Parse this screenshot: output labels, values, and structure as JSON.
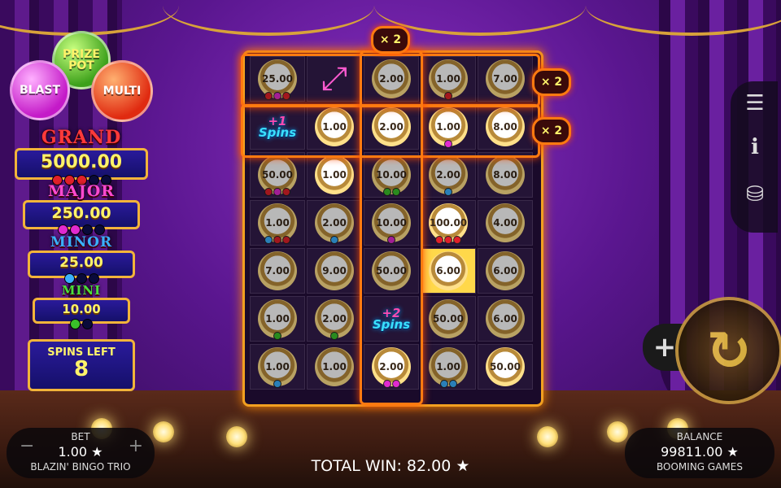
{
  "orbs": {
    "prize": "PRIZE POT",
    "blast": "BLAST",
    "multi": "MULTI"
  },
  "jackpots": [
    {
      "name": "GRAND",
      "value": "5000.00",
      "color": "#ff3a3a",
      "dots": [
        "#e0202a",
        "#e0202a",
        "#e0202a",
        "#0a0a3a",
        "#0a0a3a"
      ]
    },
    {
      "name": "MAJOR",
      "value": "250.00",
      "color": "#ff4ad0",
      "dots": [
        "#e02ad0",
        "#e02ad0",
        "#0a0a3a",
        "#0a0a3a"
      ]
    },
    {
      "name": "MINOR",
      "value": "25.00",
      "color": "#3ab0ff",
      "dots": [
        "#3ab0ff",
        "#0a0a3a",
        "#0a0a3a"
      ]
    },
    {
      "name": "MINI",
      "value": "10.00",
      "color": "#4ae03a",
      "dots": [
        "#3ac02a",
        "#0a0a3a"
      ]
    }
  ],
  "spins_left": {
    "label": "SPINS LEFT",
    "value": "8"
  },
  "multipliers": {
    "col": "× 2",
    "row1": "× 2",
    "row2": "× 2"
  },
  "grid": [
    [
      {
        "v": "25.00",
        "d": [
          "#e0202a",
          "#e02ad0",
          "#e0202a"
        ],
        "dim": true
      },
      {
        "t": "arrow"
      },
      {
        "v": "2.00",
        "dim": true
      },
      {
        "v": "1.00",
        "d": [
          "#e0202a"
        ],
        "dim": true
      },
      {
        "v": "7.00",
        "dim": true
      }
    ],
    [
      {
        "t": "spins",
        "s": "+1",
        "w": "Spins"
      },
      {
        "v": "1.00"
      },
      {
        "v": "2.00"
      },
      {
        "v": "1.00",
        "d": [
          "#e02ad0"
        ]
      },
      {
        "v": "8.00"
      }
    ],
    [
      {
        "v": "50.00",
        "d": [
          "#e0202a",
          "#e02ad0",
          "#e0202a"
        ],
        "dim": true
      },
      {
        "v": "1.00"
      },
      {
        "v": "10.00",
        "d": [
          "#3ac02a",
          "#3ac02a"
        ],
        "dim": true
      },
      {
        "v": "2.00",
        "d": [
          "#3ab0ff"
        ],
        "dim": true
      },
      {
        "v": "8.00",
        "dim": true
      }
    ],
    [
      {
        "v": "1.00",
        "d": [
          "#3ab0ff",
          "#e0202a",
          "#e0202a"
        ],
        "dim": true
      },
      {
        "v": "2.00",
        "d": [
          "#3ab0ff"
        ],
        "dim": true
      },
      {
        "v": "10.00",
        "d": [
          "#e02ad0"
        ],
        "dim": true
      },
      {
        "v": "100.00",
        "d": [
          "#e0202a",
          "#e0202a",
          "#e0202a"
        ]
      },
      {
        "v": "4.00",
        "dim": true
      }
    ],
    [
      {
        "v": "7.00",
        "dim": true
      },
      {
        "v": "9.00",
        "dim": true
      },
      {
        "v": "50.00",
        "dim": true
      },
      {
        "v": "6.00",
        "hl": true
      },
      {
        "v": "6.00",
        "dim": true
      }
    ],
    [
      {
        "v": "1.00",
        "d": [
          "#3ac02a"
        ],
        "dim": true
      },
      {
        "v": "2.00",
        "d": [
          "#3ac02a"
        ],
        "dim": true
      },
      {
        "t": "spins",
        "s": "+2",
        "w": "Spins"
      },
      {
        "v": "50.00",
        "dim": true
      },
      {
        "v": "6.00",
        "dim": true
      }
    ],
    [
      {
        "v": "1.00",
        "d": [
          "#3ab0ff"
        ],
        "dim": true
      },
      {
        "v": "1.00",
        "dim": true
      },
      {
        "v": "2.00",
        "d": [
          "#e02ad0",
          "#e02ad0"
        ]
      },
      {
        "v": "1.00",
        "d": [
          "#3ab0ff",
          "#3ab0ff"
        ],
        "dim": true
      },
      {
        "v": "50.00"
      }
    ]
  ],
  "bet": {
    "label": "BET",
    "value": "1.00 ★",
    "game": "BLAZIN' BINGO TRIO",
    "minus": "−",
    "plus": "+"
  },
  "balance": {
    "label": "BALANCE",
    "value": "99811.00 ★",
    "brand": "BOOMING GAMES"
  },
  "total_win": "TOTAL WIN: 82.00 ★",
  "controls": {
    "plus": "+",
    "spin": "↻"
  }
}
